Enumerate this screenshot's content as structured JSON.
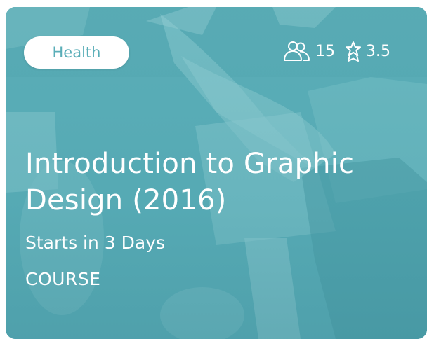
{
  "card": {
    "category": "Health",
    "students": "15",
    "rating": "3.5",
    "title": "Introduction to Graphic Design (2016)",
    "starts": "Starts in 3 Days",
    "type": "COURSE",
    "colors": {
      "tint": "#5fb0b9",
      "badge_text": "#5aaeb8",
      "text": "#ffffff"
    },
    "icons": {
      "students": "users-icon",
      "rating": "star-ribbon-icon"
    }
  }
}
